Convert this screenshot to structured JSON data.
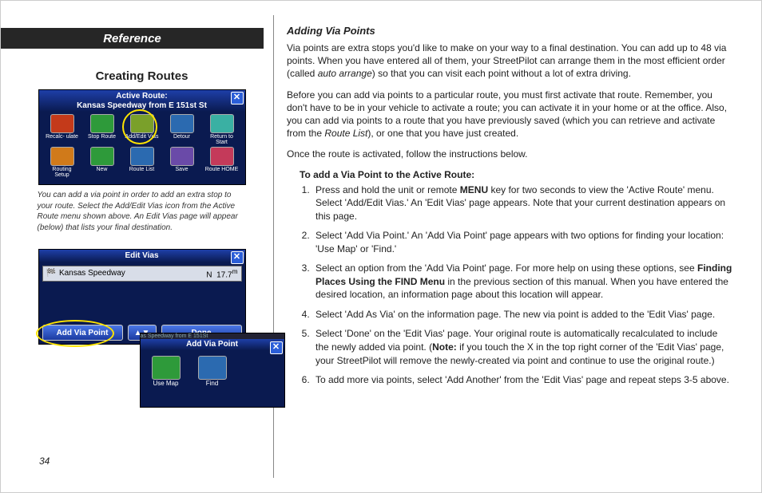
{
  "page_number": "34",
  "left": {
    "ref_title": "Reference",
    "section_title": "Creating Routes",
    "screenshot1": {
      "title_line1": "Active Route:",
      "title_line2": "Kansas Speedway from E 151st St",
      "close": "✕",
      "icons": [
        {
          "label": "Recalc-\nulate",
          "color": "#c43a1a"
        },
        {
          "label": "Stop\nRoute",
          "color": "#2e9a3a"
        },
        {
          "label": "Add/Edit\nVias",
          "color": "#7aa02a"
        },
        {
          "label": "Detour",
          "color": "#2b6ab0"
        },
        {
          "label": "Return\nto Start",
          "color": "#3ab0a3"
        },
        {
          "label": "Routing\nSetup",
          "color": "#d07a1a"
        },
        {
          "label": "New",
          "color": "#2e9a3a"
        },
        {
          "label": "Route\nList",
          "color": "#2b6ab0"
        },
        {
          "label": "Save",
          "color": "#6a4aa8"
        },
        {
          "label": "Route\nHOME",
          "color": "#c43a5a"
        }
      ]
    },
    "caption": "You can add a via point in order to add an extra stop to your route. Select the Add/Edit Vias icon from the Active Route menu shown above. An Edit Vias page will appear (below) that lists your final destination.",
    "screenshot2": {
      "title": "Edit Vias",
      "close": "✕",
      "row_left": "Kansas Speedway",
      "row_right_dir": "N",
      "row_right_dist": "17.7",
      "row_right_unit": "m",
      "btn_add": "Add Via Point",
      "btn_arrows": "▲▼",
      "btn_done": "Done"
    },
    "mini": {
      "breadcrumb": "as Speedway from E 151St",
      "title": "Add Via Point",
      "close": "✕",
      "icons": [
        {
          "label": "Use Map",
          "color": "#2e9a3a"
        },
        {
          "label": "Find",
          "color": "#2b6ab0"
        }
      ]
    }
  },
  "right": {
    "heading": "Adding Via Points",
    "p1_a": "Via points are extra stops you'd like to make on your way to a final destination. You can add up to 48 via points. When you have entered all of them, your StreetPilot can arrange them in the most efficient order (called ",
    "p1_i": "auto arrange",
    "p1_b": ") so that you can visit each point without a lot of extra driving.",
    "p2_a": "Before you can add via points to a particular route, you must first activate that route. Remember, you don't have to be in your vehicle to activate a route; you can activate it in your home or at the office. Also, you can add via points to a route that you have previously saved (which you can retrieve and activate from the ",
    "p2_i": "Route List",
    "p2_b": "), or one that you have just created.",
    "p3": "Once the route is activated, follow the instructions below.",
    "list_head": "To add a Via Point to the Active Route:",
    "steps": {
      "s1_a": "Press and hold the unit or remote ",
      "s1_bold": "MENU",
      "s1_b": " key for two seconds to view the 'Active Route' menu. Select 'Add/Edit Vias.'  An 'Edit Vias' page appears. Note that your current destination appears on this page.",
      "s2": "Select 'Add Via Point.'  An 'Add Via Point' page appears with two options for finding your location: 'Use Map' or 'Find.'",
      "s3_a": "Select an option from the 'Add Via Point' page.  For more help on using these options, see ",
      "s3_bold": "Finding Places Using the FIND Menu",
      "s3_b": " in the previous section of this manual. When you have entered the desired location, an information page about this location will appear.",
      "s4": "Select 'Add As Via' on the information page. The new via point is added to the 'Edit Vias' page.",
      "s5_a": "Select 'Done' on the 'Edit Vias' page. Your original route is automatically recalculated to include the newly added via point.  (",
      "s5_bold": "Note:",
      "s5_b": " if you touch the X in the top right corner of the 'Edit Vias' page, your StreetPilot will remove the newly-created via point and continue to use the original route.)",
      "s6": "To add more via points, select 'Add Another' from the 'Edit Vias' page and repeat steps 3-5 above."
    }
  }
}
